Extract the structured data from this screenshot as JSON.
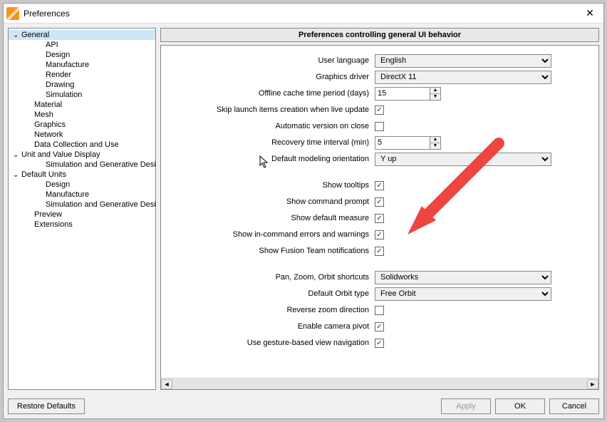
{
  "window": {
    "title": "Preferences"
  },
  "tree": [
    {
      "label": "General",
      "depth": 0,
      "sel": true,
      "exp": true
    },
    {
      "label": "API",
      "depth": 2
    },
    {
      "label": "Design",
      "depth": 2
    },
    {
      "label": "Manufacture",
      "depth": 2
    },
    {
      "label": "Render",
      "depth": 2
    },
    {
      "label": "Drawing",
      "depth": 2
    },
    {
      "label": "Simulation",
      "depth": 2
    },
    {
      "label": "Material",
      "depth": 1
    },
    {
      "label": "Mesh",
      "depth": 1
    },
    {
      "label": "Graphics",
      "depth": 1
    },
    {
      "label": "Network",
      "depth": 1
    },
    {
      "label": "Data Collection and Use",
      "depth": 1
    },
    {
      "label": "Unit and Value Display",
      "depth": 0,
      "exp": true
    },
    {
      "label": "Simulation and Generative Design",
      "depth": 2
    },
    {
      "label": "Default Units",
      "depth": 0,
      "exp": true
    },
    {
      "label": "Design",
      "depth": 2
    },
    {
      "label": "Manufacture",
      "depth": 2
    },
    {
      "label": "Simulation and Generative Design",
      "depth": 2
    },
    {
      "label": "Preview",
      "depth": 1
    },
    {
      "label": "Extensions",
      "depth": 1
    }
  ],
  "banner": "Preferences controlling general UI behavior",
  "labels": {
    "user_language": "User language",
    "graphics_driver": "Graphics driver",
    "offline_cache": "Offline cache time period (days)",
    "skip_launch": "Skip launch items creation when live update",
    "auto_version": "Automatic version on close",
    "recovery_interval": "Recovery time interval (min)",
    "default_orientation": "Default modeling orientation",
    "show_tooltips": "Show tooltips",
    "show_cmd_prompt": "Show command prompt",
    "show_default_measure": "Show default measure",
    "show_incmd_err": "Show in-command errors and warnings",
    "show_fusion_team": "Show Fusion Team notifications",
    "pzo_shortcuts": "Pan, Zoom, Orbit shortcuts",
    "default_orbit": "Default Orbit type",
    "reverse_zoom": "Reverse zoom direction",
    "enable_pivot": "Enable camera pivot",
    "gesture_nav": "Use gesture-based view navigation"
  },
  "values": {
    "user_language": "English",
    "graphics_driver": "DirectX 11",
    "offline_cache": "15",
    "skip_launch": true,
    "auto_version": false,
    "recovery_interval": "5",
    "default_orientation": "Y up",
    "show_tooltips": true,
    "show_cmd_prompt": true,
    "show_default_measure": true,
    "show_incmd_err": true,
    "show_fusion_team": true,
    "pzo_shortcuts": "Solidworks",
    "default_orbit": "Free Orbit",
    "reverse_zoom": false,
    "enable_pivot": true,
    "gesture_nav": true
  },
  "buttons": {
    "restore": "Restore Defaults",
    "apply": "Apply",
    "ok": "OK",
    "cancel": "Cancel"
  }
}
